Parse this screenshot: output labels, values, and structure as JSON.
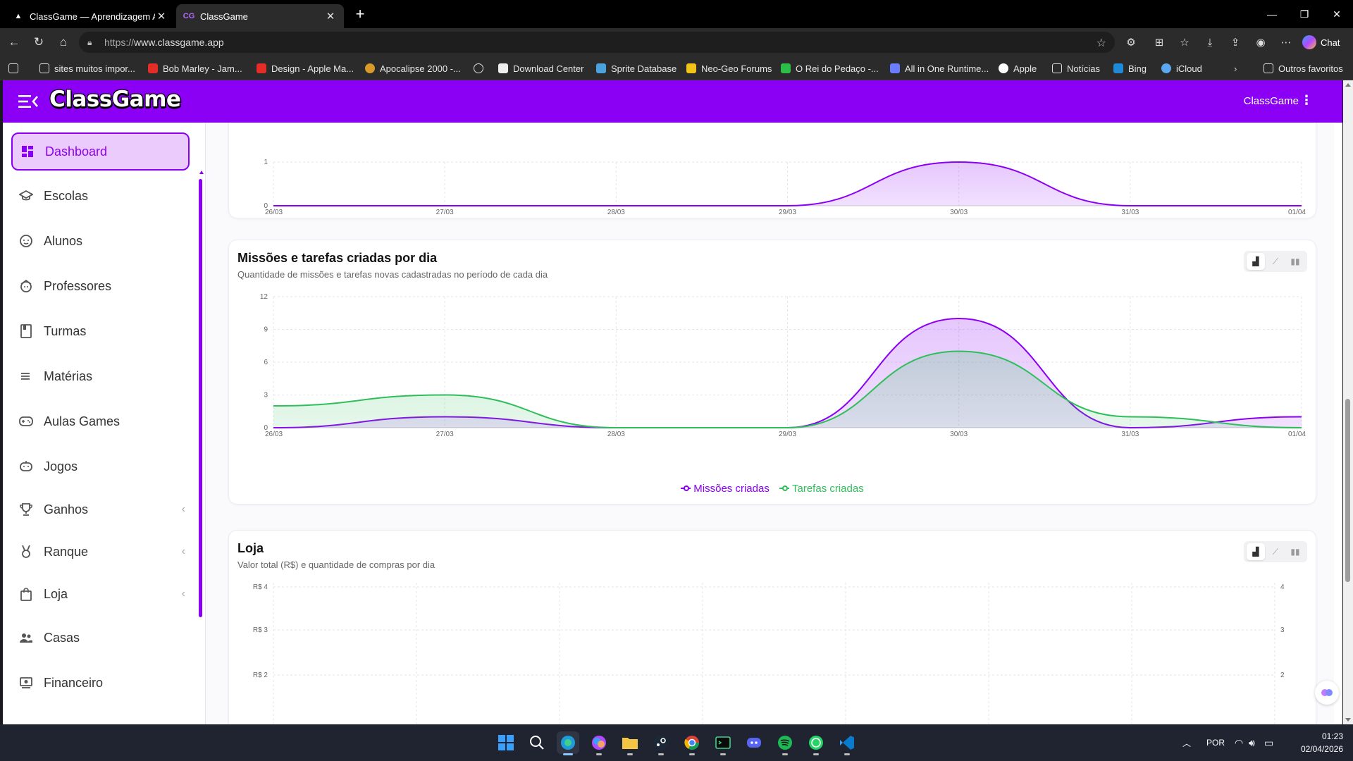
{
  "browser": {
    "tabs": [
      {
        "title": "ClassGame — Aprendizagem Adaptativa"
      },
      {
        "title": "ClassGame"
      }
    ],
    "url_scheme": "https://",
    "url_host": "www.classgame.app",
    "chat_label": "Chat",
    "bookmarks": [
      {
        "label": "sites muitos impor...",
        "icon": "folder-icon"
      },
      {
        "label": "Bob Marley - Jam...",
        "icon": "youtube-icon"
      },
      {
        "label": "Design - Apple Ma...",
        "icon": "youtube-icon"
      },
      {
        "label": "Apocalipse 2000 -...",
        "icon": "star-icon"
      },
      {
        "label": "",
        "icon": "globe-icon"
      },
      {
        "label": "Download Center",
        "icon": "download-center-icon"
      },
      {
        "label": "Sprite Database",
        "icon": "sprite-icon"
      },
      {
        "label": "Neo-Geo Forums",
        "icon": "neogeo-icon"
      },
      {
        "label": "O Rei do Pedaço -...",
        "icon": "s-icon"
      },
      {
        "label": "All in One Runtime...",
        "icon": "runtime-icon"
      },
      {
        "label": "Apple",
        "icon": "apple-icon"
      },
      {
        "label": "Notícias",
        "icon": "folder-icon"
      },
      {
        "label": "Bing",
        "icon": "bing-icon"
      },
      {
        "label": "iCloud",
        "icon": "icloud-icon"
      }
    ],
    "other_favorites": "Outros favoritos"
  },
  "app": {
    "logo": "ClassGame",
    "user_label": "ClassGame",
    "brand_color": "#8b00f5"
  },
  "sidebar": {
    "items": [
      {
        "label": "Dashboard",
        "icon": "dashboard-icon",
        "active": true
      },
      {
        "label": "Escolas",
        "icon": "school-icon"
      },
      {
        "label": "Alunos",
        "icon": "student-icon"
      },
      {
        "label": "Professores",
        "icon": "teacher-icon"
      },
      {
        "label": "Turmas",
        "icon": "class-book-icon"
      },
      {
        "label": "Matérias",
        "icon": "list-icon"
      },
      {
        "label": "Aulas Games",
        "icon": "gamepad-icon"
      },
      {
        "label": "Jogos",
        "icon": "game-icon"
      },
      {
        "label": "Ganhos",
        "icon": "trophy-icon",
        "expandable": true
      },
      {
        "label": "Ranque",
        "icon": "medal-icon",
        "expandable": true
      },
      {
        "label": "Loja",
        "icon": "shopping-bag-icon",
        "expandable": true
      },
      {
        "label": "Casas",
        "icon": "group-icon"
      },
      {
        "label": "Financeiro",
        "icon": "finance-icon"
      }
    ]
  },
  "cards": {
    "top": {
      "chart_data": {
        "type": "area",
        "x": [
          "26/03",
          "27/03",
          "28/03",
          "29/03",
          "30/03",
          "31/03",
          "01/04"
        ],
        "yticks": [
          0,
          1
        ],
        "series": [
          {
            "color": "#8b00f5",
            "values": [
              0,
              0,
              0,
              0,
              1,
              0,
              0
            ]
          }
        ]
      }
    },
    "missions": {
      "title": "Missões e tarefas criadas por dia",
      "subtitle": "Quantidade de missões e tarefas novas cadastradas no período de cada dia",
      "chart_data": {
        "type": "area",
        "x": [
          "26/03",
          "27/03",
          "28/03",
          "29/03",
          "30/03",
          "31/03",
          "01/04"
        ],
        "ylim": [
          0,
          12
        ],
        "yticks": [
          0,
          3,
          6,
          9,
          12
        ],
        "series": [
          {
            "name": "Missões criadas",
            "color": "#8b00f5",
            "values": [
              0,
              1,
              0,
              0,
              10,
              0,
              1
            ]
          },
          {
            "name": "Tarefas criadas",
            "color": "#2fbf5a",
            "values": [
              2,
              3,
              0,
              0,
              7,
              1,
              0
            ]
          }
        ],
        "legend": "bottom"
      }
    },
    "store": {
      "title": "Loja",
      "subtitle": "Valor total (R$) e quantidade de compras por dia",
      "chart_data": {
        "type": "bar",
        "yticks_left": [
          "R$ 4",
          "R$ 3",
          "R$ 2"
        ],
        "yticks_right": [
          "4",
          "3",
          "2"
        ],
        "series": []
      }
    }
  },
  "taskbar": {
    "lang": "POR",
    "time": "01:23",
    "date": "02/04/2026"
  }
}
